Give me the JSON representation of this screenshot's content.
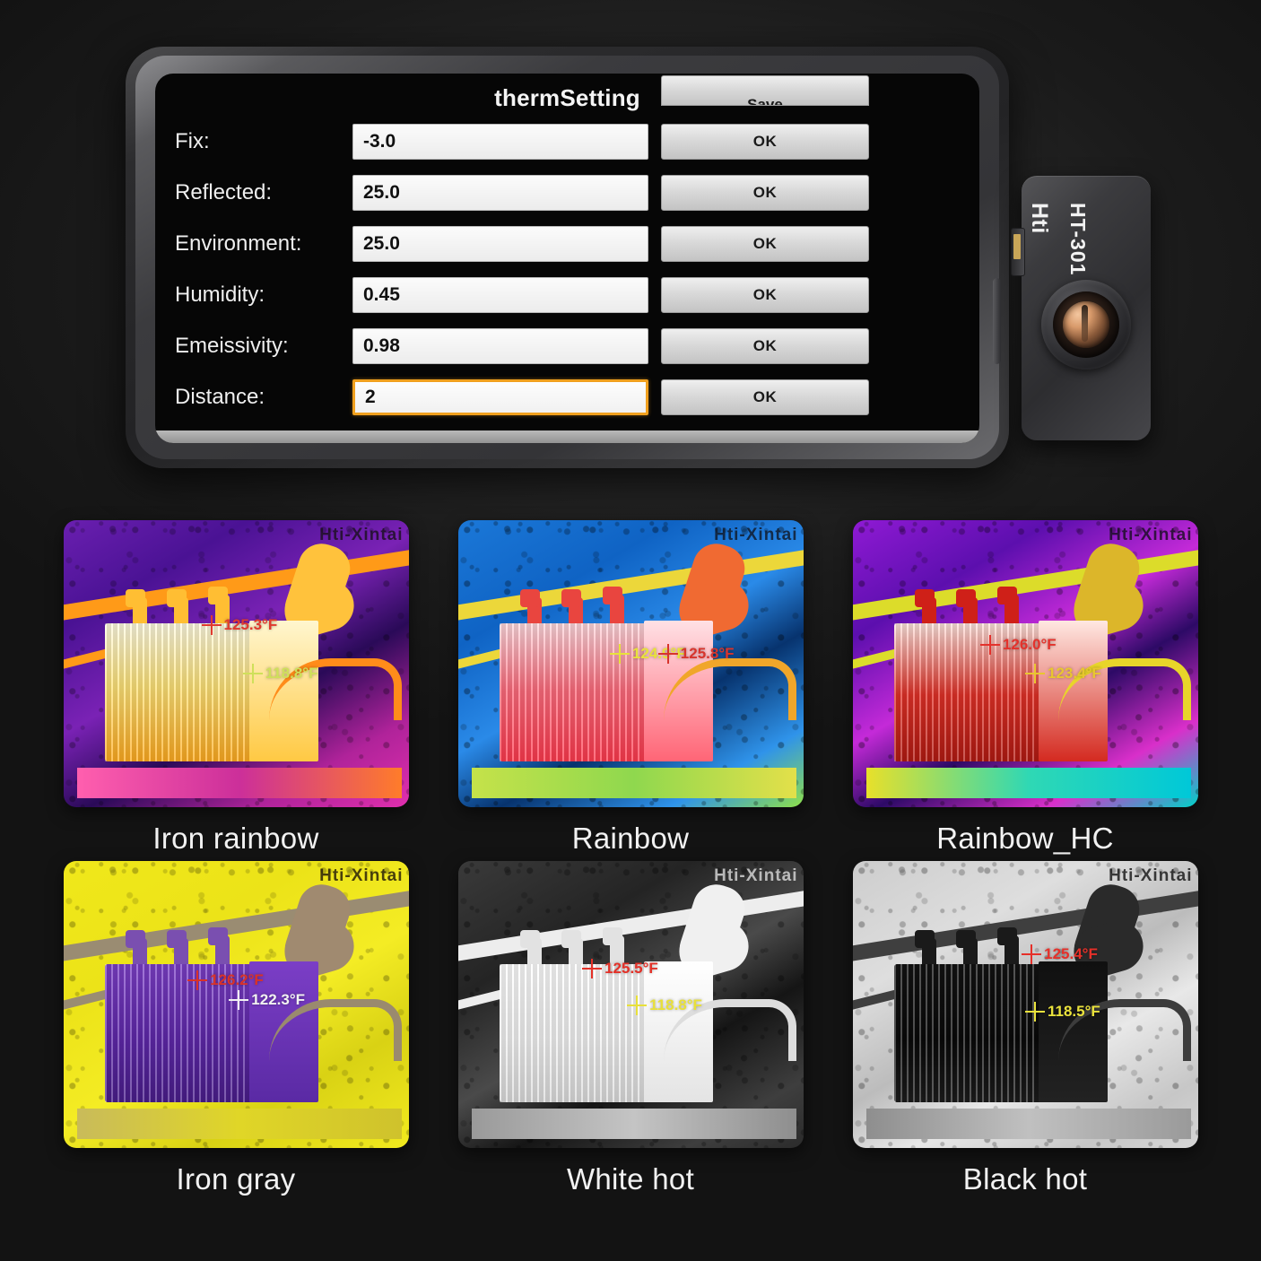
{
  "phone": {
    "app_title": "thermSetting",
    "ok_label": "OK",
    "save_label": "Save",
    "settings": [
      {
        "label": "Fix:",
        "value": "-3.0",
        "focused": false
      },
      {
        "label": "Reflected:",
        "value": "25.0",
        "focused": false
      },
      {
        "label": "Environment:",
        "value": "25.0",
        "focused": false
      },
      {
        "label": "Humidity:",
        "value": "0.45",
        "focused": false
      },
      {
        "label": "Emeissivity:",
        "value": "0.98",
        "focused": false
      },
      {
        "label": "Distance:",
        "value": "2",
        "focused": true
      }
    ],
    "nav_icons": [
      "recents-square-icon",
      "home-circle-icon",
      "back-triangle-icon"
    ]
  },
  "device": {
    "brand": "Hti",
    "model": "HT-301"
  },
  "watermark": "Hti-Xintai",
  "palettes": [
    {
      "caption": "Iron rainbow",
      "watermark": "Hti-Xintai",
      "wm_color": "#1c1020",
      "markers": [
        {
          "value": "125.3°F",
          "color": "#e03a2f",
          "x": 40,
          "y": 33
        },
        {
          "value": "118.8°F",
          "color": "#cfe05a",
          "x": 52,
          "y": 50
        }
      ]
    },
    {
      "caption": "Rainbow",
      "watermark": "Hti-Xintai",
      "wm_color": "#101a2a",
      "markers": [
        {
          "value": "124.9°F",
          "color": "#e8e23a",
          "x": 44,
          "y": 43
        },
        {
          "value": "125.8°F",
          "color": "#d8342c",
          "x": 58,
          "y": 43
        }
      ]
    },
    {
      "caption": "Rainbow_HC",
      "watermark": "Hti-Xintai",
      "wm_color": "#1a0e24",
      "markers": [
        {
          "value": "126.0°F",
          "color": "#e4322c",
          "x": 37,
          "y": 40
        },
        {
          "value": "123.4°F",
          "color": "#e9c62f",
          "x": 50,
          "y": 50
        }
      ]
    },
    {
      "caption": "Iron gray",
      "watermark": "Hti-Xintai",
      "wm_color": "#241b08",
      "markers": [
        {
          "value": "126.2°F",
          "color": "#d93229",
          "x": 36,
          "y": 38
        },
        {
          "value": "122.3°F",
          "color": "#f2f2f2",
          "x": 48,
          "y": 45
        }
      ]
    },
    {
      "caption": "White hot",
      "watermark": "Hti-Xintai",
      "wm_color": "#d8d8d8",
      "markers": [
        {
          "value": "125.5°F",
          "color": "#e43128",
          "x": 36,
          "y": 34
        },
        {
          "value": "118.8°F",
          "color": "#e8e03a",
          "x": 49,
          "y": 47
        }
      ]
    },
    {
      "caption": "Black hot",
      "watermark": "Hti-Xintai",
      "wm_color": "#171717",
      "markers": [
        {
          "value": "125.4°F",
          "color": "#e63029",
          "x": 49,
          "y": 29
        },
        {
          "value": "118.5°F",
          "color": "#eae23c",
          "x": 50,
          "y": 49
        }
      ]
    }
  ]
}
